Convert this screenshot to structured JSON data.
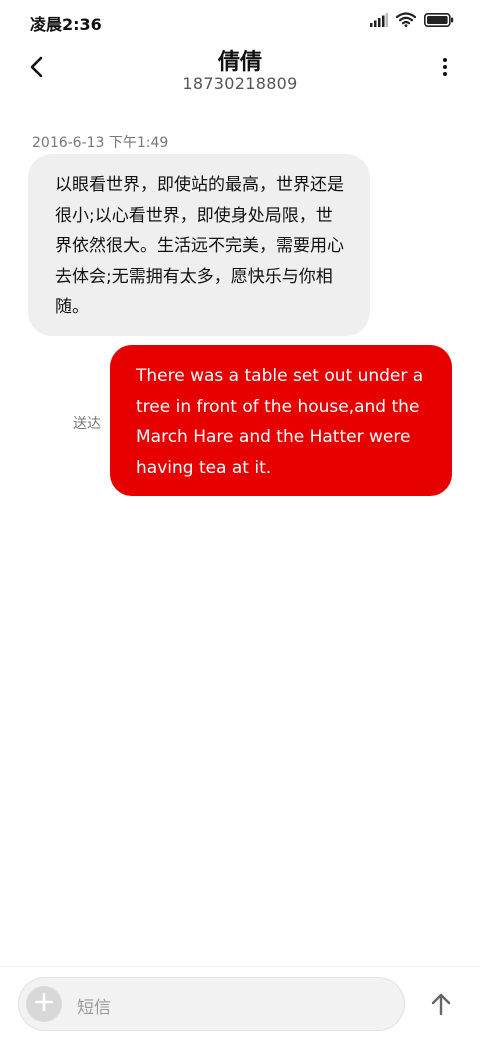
{
  "status_bar": {
    "time": "凌晨2:36",
    "icons": [
      "signal-icon",
      "wifi-icon",
      "battery-icon"
    ]
  },
  "header": {
    "back_icon": "chevron-left-icon",
    "contact_name": "倩倩",
    "phone_number": "18730218809",
    "more_icon": "more-vertical-icon"
  },
  "messages": [
    {
      "direction": "incoming",
      "timestamp": "2016-6-13 下午1:49",
      "text": "以眼看世界，即使站的最高，世界还是很小;以心看世界，即使身处局限，世界依然很大。生活远不完美，需要用心去体会;无需拥有太多，愿快乐与你相随。",
      "bubble_color": "#efefef"
    },
    {
      "direction": "outgoing",
      "status": "送达",
      "text": "There was a table set out under a tree in front of the house,and the March Hare and the Hatter were having tea at it.",
      "bubble_color": "#e60000"
    }
  ],
  "composer": {
    "attach_icon": "plus-icon",
    "placeholder": "短信",
    "send_icon": "arrow-up-icon"
  },
  "colors": {
    "accent": "#e60000",
    "incoming_bubble": "#efefef",
    "secondary_text": "#777777"
  }
}
